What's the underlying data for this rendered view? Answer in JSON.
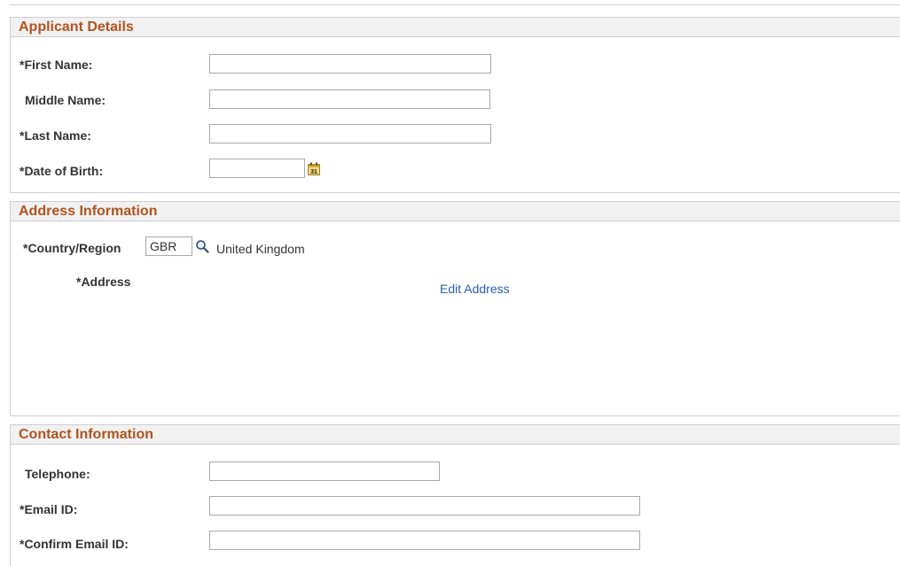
{
  "applicant": {
    "title": "Applicant Details",
    "first_name_label": "*First Name:",
    "first_name_value": "",
    "middle_name_label": "Middle Name:",
    "middle_name_value": "",
    "last_name_label": "*Last Name:",
    "last_name_value": "",
    "dob_label": "*Date of Birth:",
    "dob_value": "",
    "calendar_icon": "calendar-icon",
    "calendar_day": "31"
  },
  "address": {
    "title": "Address Information",
    "country_label": "*Country/Region",
    "country_code": "GBR",
    "lookup_icon": "search-icon",
    "country_name": "United Kingdom",
    "address_label": "*Address",
    "edit_link": "Edit Address"
  },
  "contact": {
    "title": "Contact Information",
    "telephone_label": "Telephone:",
    "telephone_value": "",
    "email_label": "*Email ID:",
    "email_value": "",
    "confirm_email_label": "*Confirm Email ID:",
    "confirm_email_value": ""
  },
  "colors": {
    "section_title": "#b0541f",
    "header_bg": "#f1f1f1",
    "link": "#2a5db0"
  }
}
